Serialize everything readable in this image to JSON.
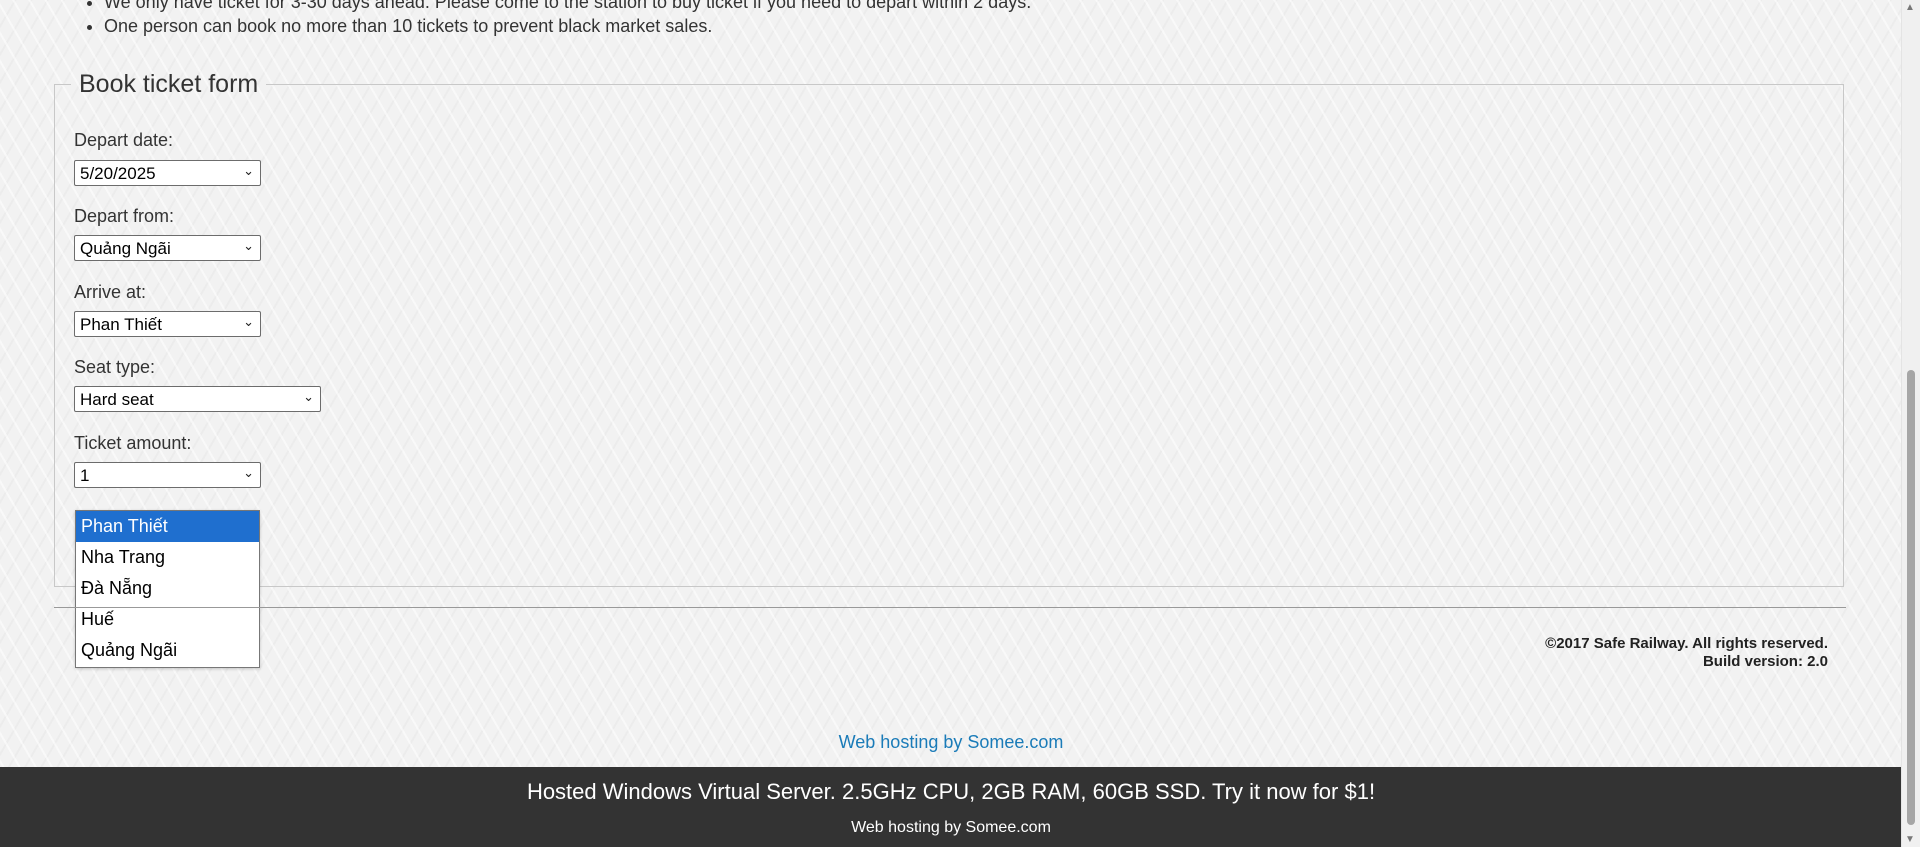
{
  "rules": [
    "We only have ticket for 3-30 days ahead. Please come to the station to buy ticket if you need to depart within 2 days.",
    "One person can book no more than 10 tickets to prevent black market sales."
  ],
  "form": {
    "title": "Book ticket form",
    "depart_date": {
      "label": "Depart date:",
      "value": "5/20/2025"
    },
    "depart_from": {
      "label": "Depart from:",
      "value": "Quảng Ngãi"
    },
    "arrive_at": {
      "label": "Arrive at:",
      "value": "Phan Thiết"
    },
    "seat_type": {
      "label": "Seat type:",
      "value": "Hard seat"
    },
    "ticket_amount": {
      "label": "Ticket amount:",
      "value": "1"
    },
    "arrive_options": [
      "Phan Thiết",
      "Nha Trang",
      "Đà Nẵng",
      "Huế",
      "Quảng Ngãi"
    ],
    "selected_option": "Phan Thiết"
  },
  "footer": {
    "copyright": "©2017 Safe Railway. All rights reserved.",
    "build": "Build version: 2.0"
  },
  "hosting": {
    "link": "Web hosting by Somee.com",
    "banner_title": "Hosted Windows Virtual Server. 2.5GHz CPU, 2GB RAM, 60GB SSD. Try it now for $1!",
    "banner_sub": "Web hosting by Somee.com"
  },
  "colors": {
    "accent_link": "#1a7bb8",
    "selected_option": "#1f6fcf",
    "banner_bg": "#333333"
  },
  "icons": {
    "select_arrow": "chevron-down-icon"
  }
}
